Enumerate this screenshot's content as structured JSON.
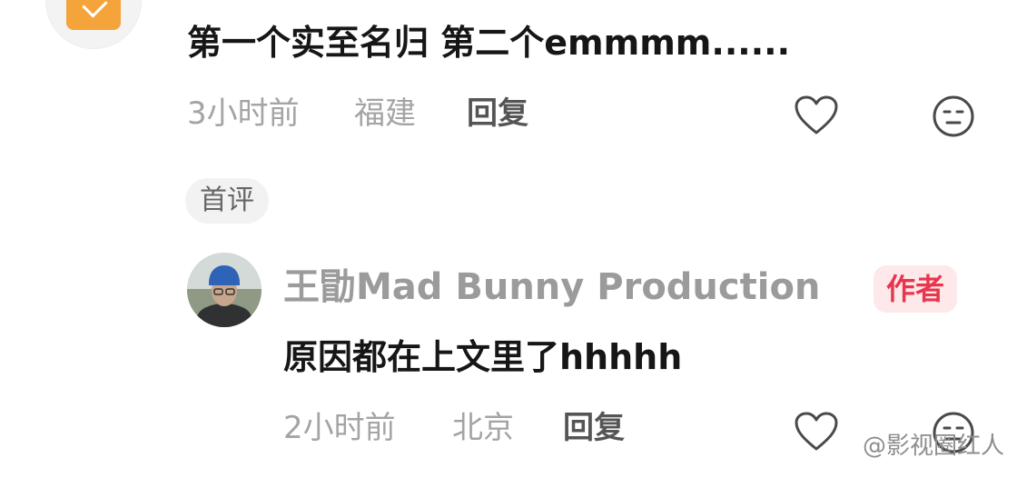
{
  "top_comment": {
    "text": "第一个实至名归 第二个emmmm......",
    "time": "3小时前",
    "location": "福建",
    "reply_label": "回复"
  },
  "reply_comment": {
    "tag": "首评",
    "author_name": "王勖Mad Bunny Production",
    "author_badge": "作者",
    "text": "原因都在上文里了hhhhh",
    "time": "2小时前",
    "location": "北京",
    "reply_label": "回复"
  },
  "watermark": "@影视圈红人",
  "colors": {
    "author_badge_text": "#e8364f",
    "author_badge_bg": "#fde8ea",
    "meta_text": "#a4a4a4"
  },
  "icons": [
    "heart-outline-icon",
    "neutral-face-icon"
  ]
}
